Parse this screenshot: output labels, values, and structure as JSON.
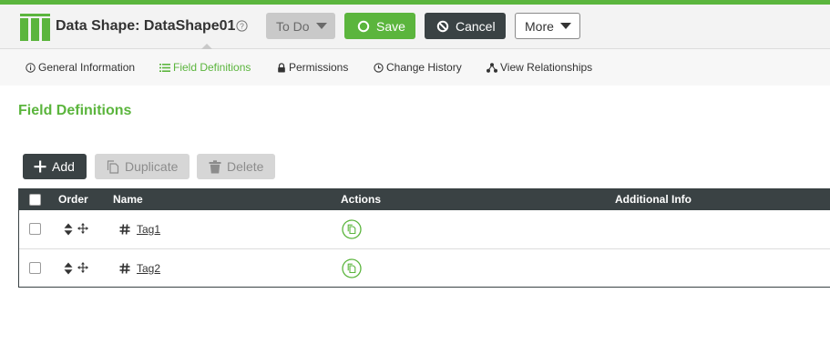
{
  "header": {
    "title": "Data Shape: DataShape01",
    "todo_label": "To Do",
    "save_label": "Save",
    "cancel_label": "Cancel",
    "more_label": "More"
  },
  "tabs": [
    {
      "label": "General Information",
      "icon": "info-icon"
    },
    {
      "label": "Field Definitions",
      "icon": "list-icon",
      "active": true
    },
    {
      "label": "Permissions",
      "icon": "lock-icon"
    },
    {
      "label": "Change History",
      "icon": "clock-icon"
    },
    {
      "label": "View Relationships",
      "icon": "relationships-icon"
    }
  ],
  "section": {
    "title": "Field Definitions"
  },
  "actions": {
    "add_label": "Add",
    "duplicate_label": "Duplicate",
    "delete_label": "Delete"
  },
  "grid": {
    "columns": [
      "Order",
      "Name",
      "Actions",
      "Additional Info"
    ],
    "rows": [
      {
        "name": "Tag1",
        "type_icon": "hash-icon",
        "action_icon": "duplicate-icon"
      },
      {
        "name": "Tag2",
        "type_icon": "hash-icon",
        "action_icon": "duplicate-icon"
      }
    ]
  },
  "colors": {
    "accent": "#5bb53d",
    "dark": "#3a4244",
    "disabled": "#d6d6d6"
  }
}
